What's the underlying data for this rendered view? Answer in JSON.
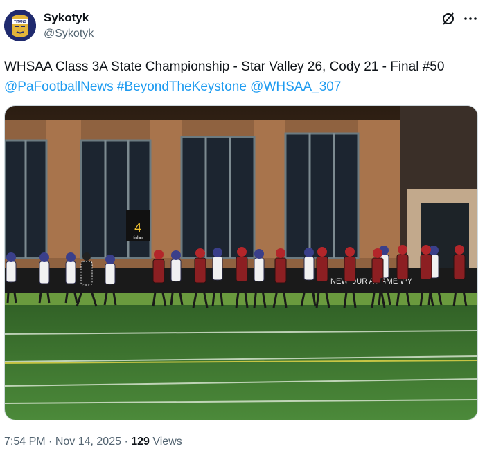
{
  "author": {
    "display_name": "Sykotyk",
    "handle": "@Sykotyk",
    "avatar_icon": "tribe-logo-avatar",
    "avatar_logo_text": "TITANS"
  },
  "toolbar": {
    "grok_icon": "grok-slash-icon",
    "more_icon": "more-dots-icon"
  },
  "tweet": {
    "text_plain": "WHSAA Class 3A State Championship - Star Valley 26, Cody 21 - Final #50 ",
    "mentions": [
      "@PaFootballNews",
      "#BeyondTheKeystone",
      "@WHSAA_307"
    ]
  },
  "media": {
    "description_icon": "football-field-photo",
    "scoreboard_digit": "4",
    "scoreboard_brand": "fnbo",
    "banner_text": "NEW OUR A NAME WY"
  },
  "meta": {
    "time": "7:54 PM",
    "separator": " · ",
    "date": "Nov 14, 2025",
    "views_count": "129",
    "views_label": " Views"
  },
  "colors": {
    "link": "#1d9bf0",
    "secondary_text": "#536471",
    "field_green": "#3f7a33",
    "brick": "#9c6b45"
  }
}
